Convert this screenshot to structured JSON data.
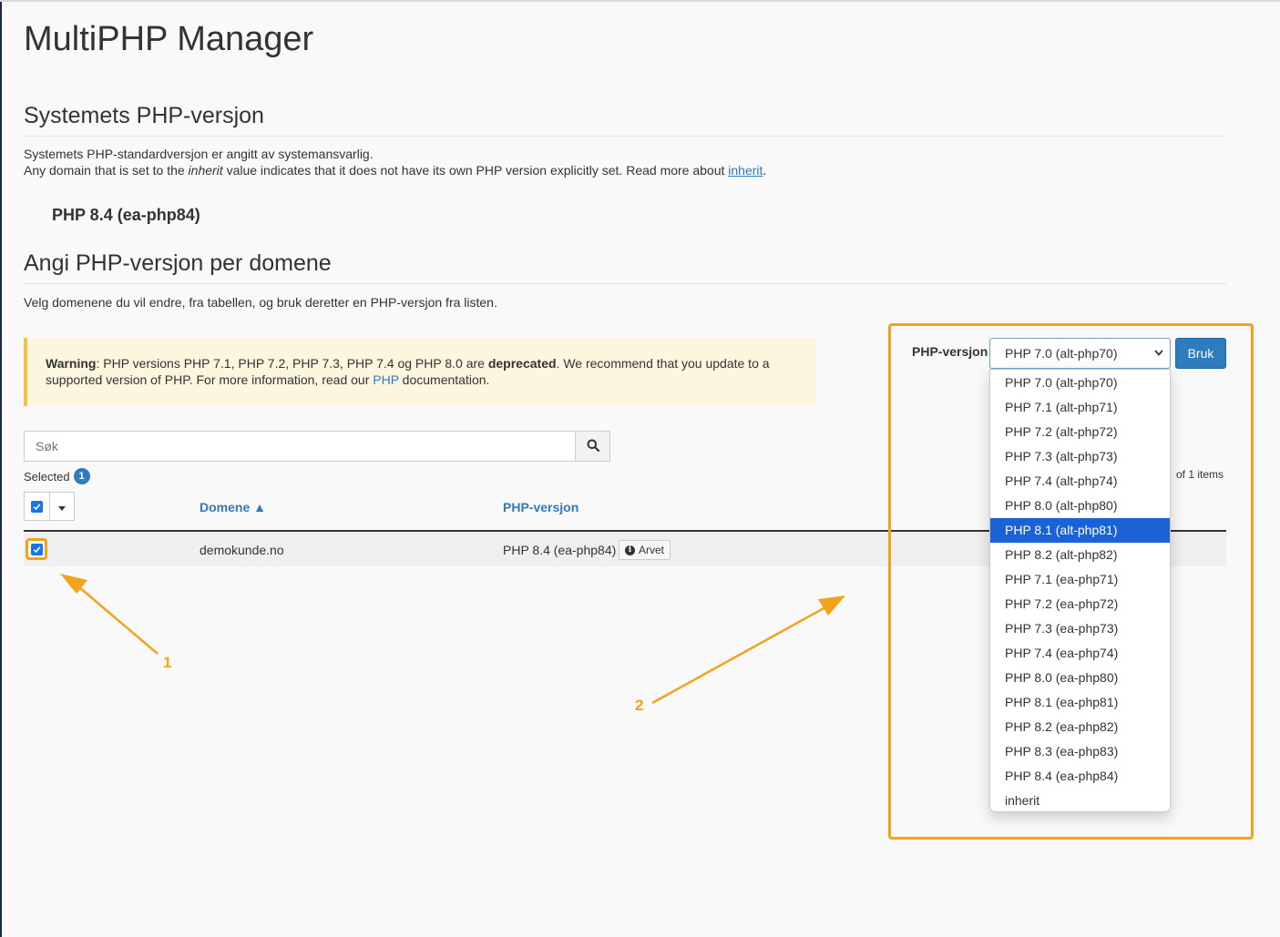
{
  "page": {
    "title": "MultiPHP Manager"
  },
  "system_section": {
    "title": "Systemets PHP-versjon",
    "line1": "Systemets PHP-standardversjon er angitt av systemansvarlig.",
    "line2_prefix": "Any domain that is set to the ",
    "line2_em": "inherit",
    "line2_mid": " value indicates that it does not have its own PHP version explicitly set. Read more about ",
    "line2_link": "inherit",
    "line2_suffix": ".",
    "current_version": "PHP 8.4 (ea-php84)"
  },
  "domain_section": {
    "title": "Angi PHP-versjon per domene",
    "description": "Velg domenene du vil endre, fra tabellen, og bruk deretter en PHP-versjon fra listen."
  },
  "warning": {
    "strong": "Warning",
    "text1": ": PHP versions PHP 7.1, PHP 7.2, PHP 7.3, PHP 7.4 og PHP 8.0 are ",
    "deprecated": "deprecated",
    "text2": ". We recommend that you update to a supported version of PHP. For more information, read our ",
    "link": "PHP",
    "text3": " documentation."
  },
  "search": {
    "placeholder": "Søk",
    "icon": "search-icon"
  },
  "selection": {
    "label": "Selected",
    "count": "1"
  },
  "table": {
    "columns": {
      "domain": "Domene ▲",
      "php": "PHP-versjon"
    },
    "rows": [
      {
        "domain": "demokunde.no",
        "php": "PHP 8.4 (ea-php84)",
        "badge": "Arvet",
        "checked": true
      }
    ],
    "items_text": "of 1 items"
  },
  "php_selector": {
    "label": "PHP-versjon",
    "selected": "PHP 7.0 (alt-php70)",
    "apply_label": "Bruk",
    "options": [
      "PHP 7.0 (alt-php70)",
      "PHP 7.1 (alt-php71)",
      "PHP 7.2 (alt-php72)",
      "PHP 7.3 (alt-php73)",
      "PHP 7.4 (alt-php74)",
      "PHP 8.0 (alt-php80)",
      "PHP 8.1 (alt-php81)",
      "PHP 8.2 (alt-php82)",
      "PHP 7.1 (ea-php71)",
      "PHP 7.2 (ea-php72)",
      "PHP 7.3 (ea-php73)",
      "PHP 7.4 (ea-php74)",
      "PHP 8.0 (ea-php80)",
      "PHP 8.1 (ea-php81)",
      "PHP 8.2 (ea-php82)",
      "PHP 8.3 (ea-php83)",
      "PHP 8.4 (ea-php84)",
      "inherit"
    ],
    "highlighted_option": "PHP 8.1 (alt-php81)"
  },
  "annotations": {
    "step1": "1",
    "step2": "2",
    "color": "#f5a21b"
  },
  "colors": {
    "accent": "#2e7bbd",
    "warning_bg": "#fcf6de",
    "warning_border": "#f3c344",
    "annotation": "#f5a21b",
    "option_highlight": "#1a62d6"
  }
}
